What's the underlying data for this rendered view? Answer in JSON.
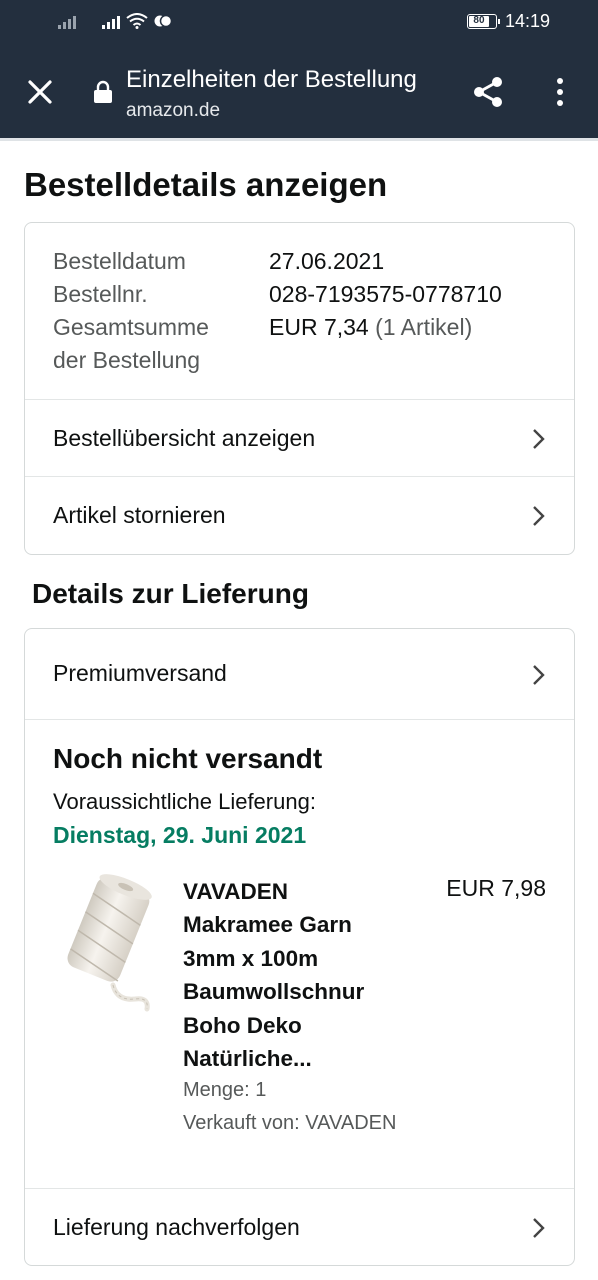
{
  "status_bar": {
    "battery": "80",
    "time": "14:19"
  },
  "browser": {
    "title": "Einzelheiten der Bestellung",
    "url": "amazon.de"
  },
  "page": {
    "title": "Bestelldetails anzeigen"
  },
  "order": {
    "date_label": "Bestelldatum",
    "date_value": "27.06.2021",
    "number_label": "Bestellnr.",
    "number_value": "028-7193575-0778710",
    "total_label_1": "Gesamtsumme",
    "total_label_2": "der Bestellung",
    "total_value": "EUR 7,34",
    "total_items": "(1 Artikel)",
    "summary_link": "Bestellübersicht anzeigen",
    "cancel_link": "Artikel stornieren"
  },
  "delivery": {
    "section_title": "Details zur Lieferung",
    "shipping_method": "Premiumversand",
    "status": "Noch nicht versandt",
    "eta_label": "Voraussichtliche Lieferung:",
    "eta_date": "Dienstag, 29. Juni 2021",
    "track_link": "Lieferung nachverfolgen"
  },
  "product": {
    "title_lines": [
      "VAVADEN",
      "Makramee Garn",
      "3mm x 100m",
      "Baumwollschnur",
      "Boho Deko",
      "Natürliche..."
    ],
    "price": "EUR 7,98",
    "quantity": "Menge: 1",
    "seller": "Verkauft von: VAVADEN",
    "image_icon": "cotton-rope-spool-image"
  },
  "colors": {
    "toolbar_bg": "#232f3e",
    "delivery_date": "#067d62",
    "border": "#d5d9d9"
  }
}
